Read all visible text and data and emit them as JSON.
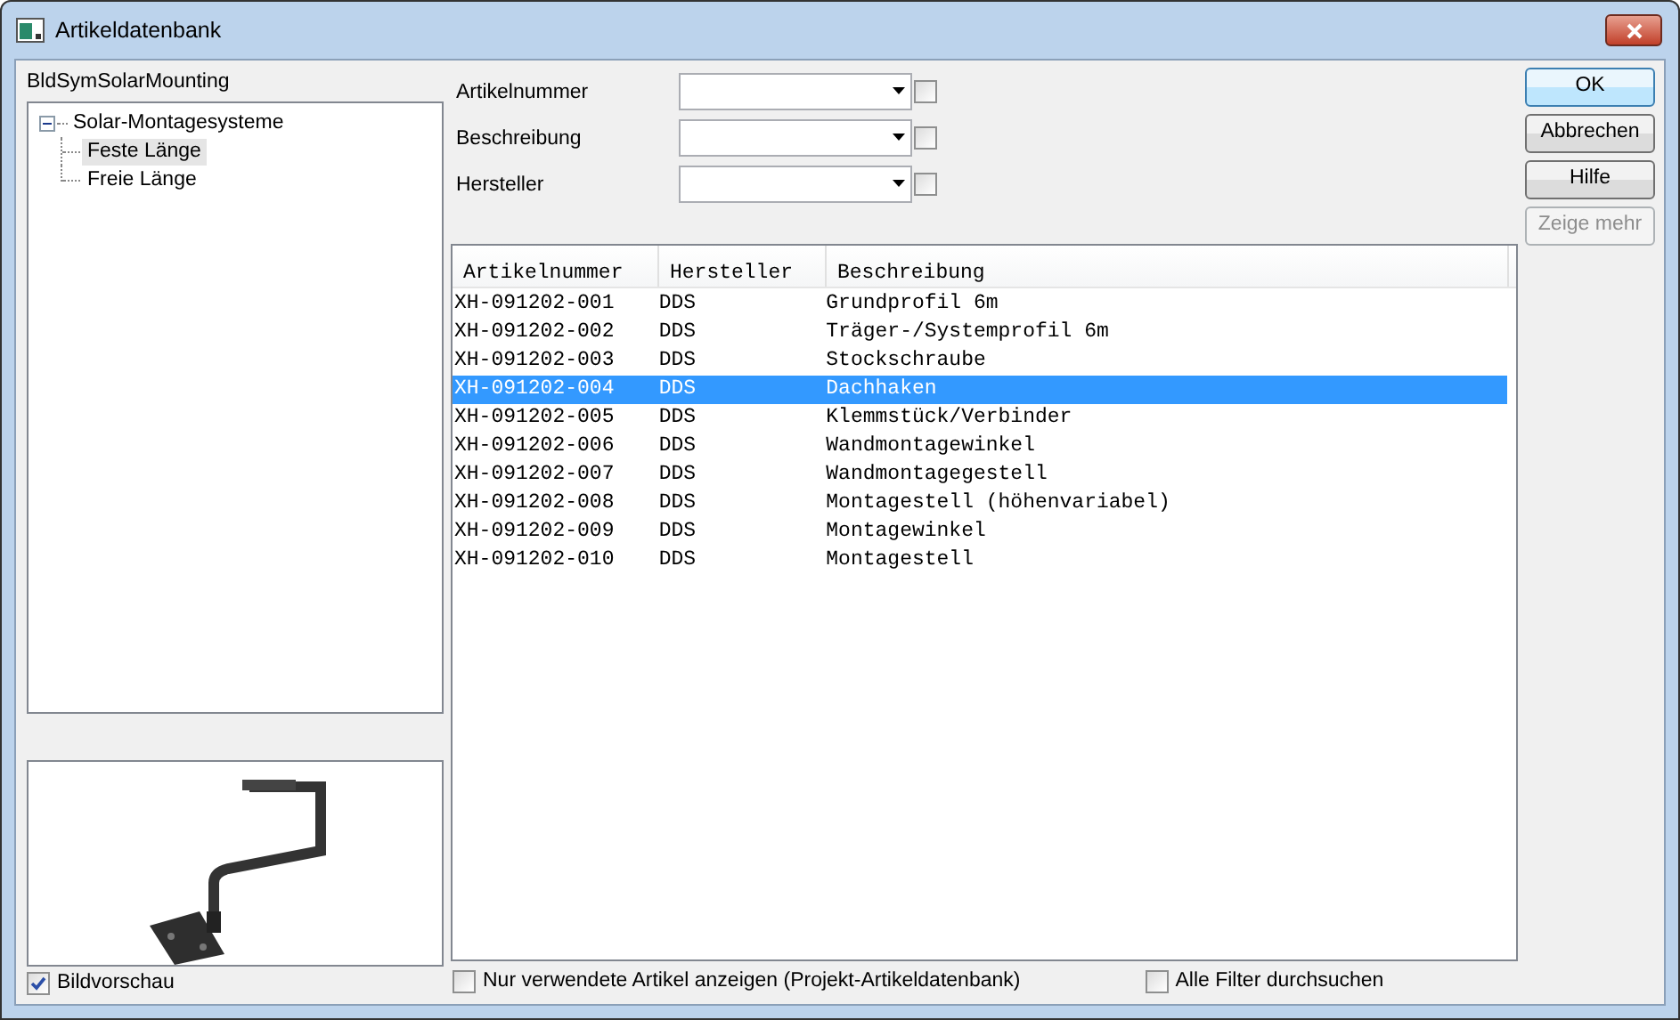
{
  "window": {
    "title": "Artikeldatenbank"
  },
  "tree": {
    "label": "BldSymSolarMounting",
    "items": [
      {
        "label": "Solar-Montagesysteme",
        "expanded": true,
        "selected": false,
        "children": [
          {
            "label": "Feste Länge",
            "selected": true
          },
          {
            "label": "Freie Länge",
            "selected": false
          }
        ]
      }
    ]
  },
  "image_preview_checkbox": {
    "label": "Bildvorschau",
    "checked": true
  },
  "filters": [
    {
      "label": "Artikelnummer",
      "checked": false
    },
    {
      "label": "Beschreibung",
      "checked": false
    },
    {
      "label": "Hersteller",
      "checked": false
    }
  ],
  "buttons": [
    {
      "label": "OK",
      "kind": "default",
      "disabled": false
    },
    {
      "label": "Abbrechen",
      "kind": "normal",
      "disabled": false
    },
    {
      "label": "Hilfe",
      "kind": "normal",
      "disabled": false
    },
    {
      "label": "Zeige mehr",
      "kind": "normal",
      "disabled": true
    }
  ],
  "table": {
    "columns": [
      "Artikelnummer",
      "Hersteller",
      "Beschreibung"
    ],
    "rows": [
      {
        "cells": [
          "XH-091202-001",
          "DDS",
          "Grundprofil 6m"
        ],
        "selected": false
      },
      {
        "cells": [
          "XH-091202-002",
          "DDS",
          "Träger-/Systemprofil 6m"
        ],
        "selected": false
      },
      {
        "cells": [
          "XH-091202-003",
          "DDS",
          "Stockschraube"
        ],
        "selected": false
      },
      {
        "cells": [
          "XH-091202-004",
          "DDS",
          "Dachhaken"
        ],
        "selected": true
      },
      {
        "cells": [
          "XH-091202-005",
          "DDS",
          "Klemmstück/Verbinder"
        ],
        "selected": false
      },
      {
        "cells": [
          "XH-091202-006",
          "DDS",
          "Wandmontagewinkel"
        ],
        "selected": false
      },
      {
        "cells": [
          "XH-091202-007",
          "DDS",
          "Wandmontagegestell"
        ],
        "selected": false
      },
      {
        "cells": [
          "XH-091202-008",
          "DDS",
          "Montagestell (höhenvariabel)"
        ],
        "selected": false
      },
      {
        "cells": [
          "XH-091202-009",
          "DDS",
          "Montagewinkel"
        ],
        "selected": false
      },
      {
        "cells": [
          "XH-091202-010",
          "DDS",
          "Montagestell"
        ],
        "selected": false
      }
    ]
  },
  "bottom_options": [
    {
      "label": "Nur verwendete Artikel anzeigen (Projekt-Artikeldatenbank)",
      "checked": false
    },
    {
      "label": "Alle Filter durchsuchen",
      "checked": false
    }
  ]
}
